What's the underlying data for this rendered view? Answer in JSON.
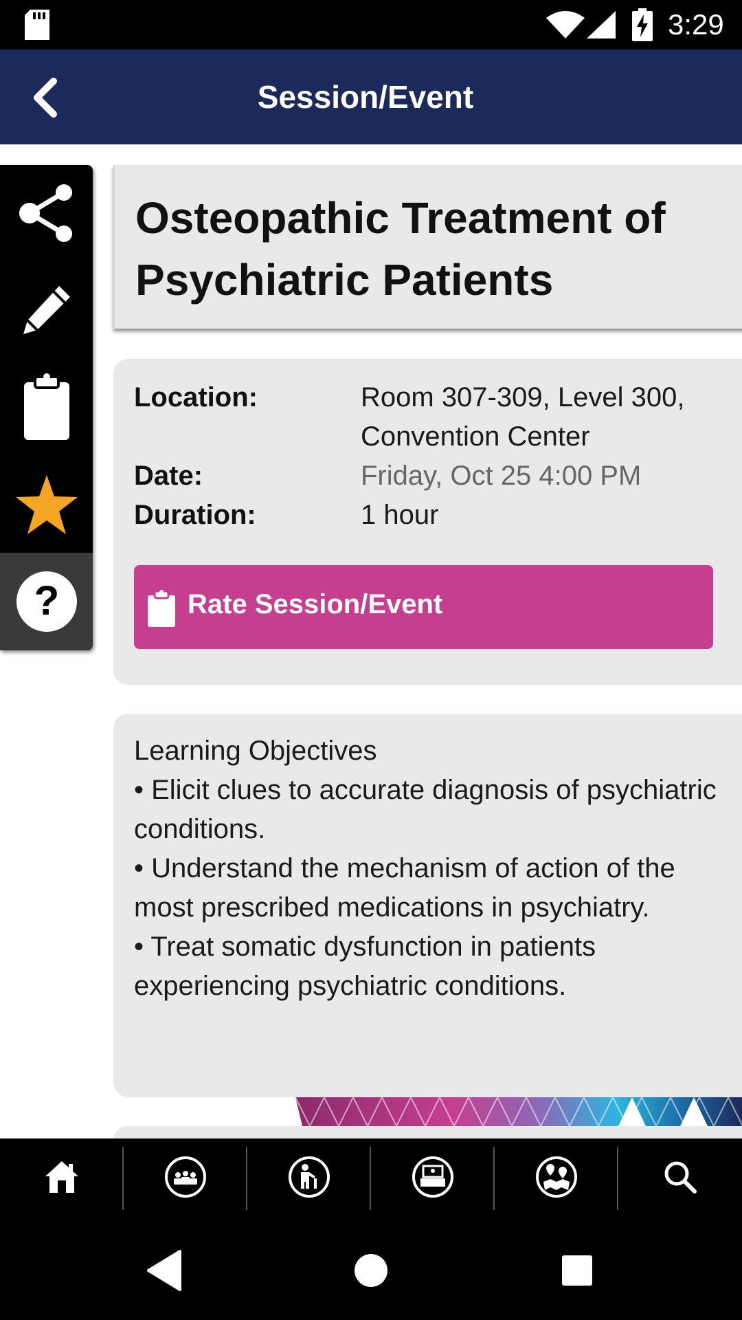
{
  "status_bar": {
    "time": "3:29",
    "icons": [
      "sd-card-icon",
      "wifi-icon",
      "signal-icon",
      "battery-charging-icon"
    ]
  },
  "header": {
    "title": "Session/Event",
    "back_icon": "chevron-left-icon"
  },
  "side_toolbar": {
    "items": [
      "share-icon",
      "pencil-icon",
      "clipboard-icon",
      "star-icon",
      "help-icon"
    ],
    "star_color": "#f5a623"
  },
  "session": {
    "title": "Osteopathic Treatment of Psychiatric Patients",
    "location_label": "Location:",
    "location_value": "Room 307-309, Level 300, Convention Center",
    "date_label": "Date:",
    "date_value": "Friday, Oct 25 4:00 PM",
    "duration_label": "Duration:",
    "duration_value": "1 hour",
    "rate_button_label": "Rate Session/Event",
    "rate_button_color": "#c63e90"
  },
  "objectives": {
    "heading": "Learning Objectives",
    "items": [
      "• Elicit clues to accurate diagnosis of psychiatric conditions.",
      "• Understand the mechanism of action of the most prescribed medications in psychiatry.",
      "• Treat somatic dysfunction in patients experiencing psychiatric conditions."
    ]
  },
  "bottom_nav": {
    "items": [
      "home-icon",
      "attendees-icon",
      "speaker-icon",
      "exhibitor-icon",
      "map-icon",
      "search-icon"
    ]
  },
  "system_nav": {
    "items": [
      "back-triangle-icon",
      "home-circle-icon",
      "recents-square-icon"
    ]
  },
  "colors": {
    "header_bg": "#1b2a5a",
    "card_bg": "#e9e9e9"
  }
}
